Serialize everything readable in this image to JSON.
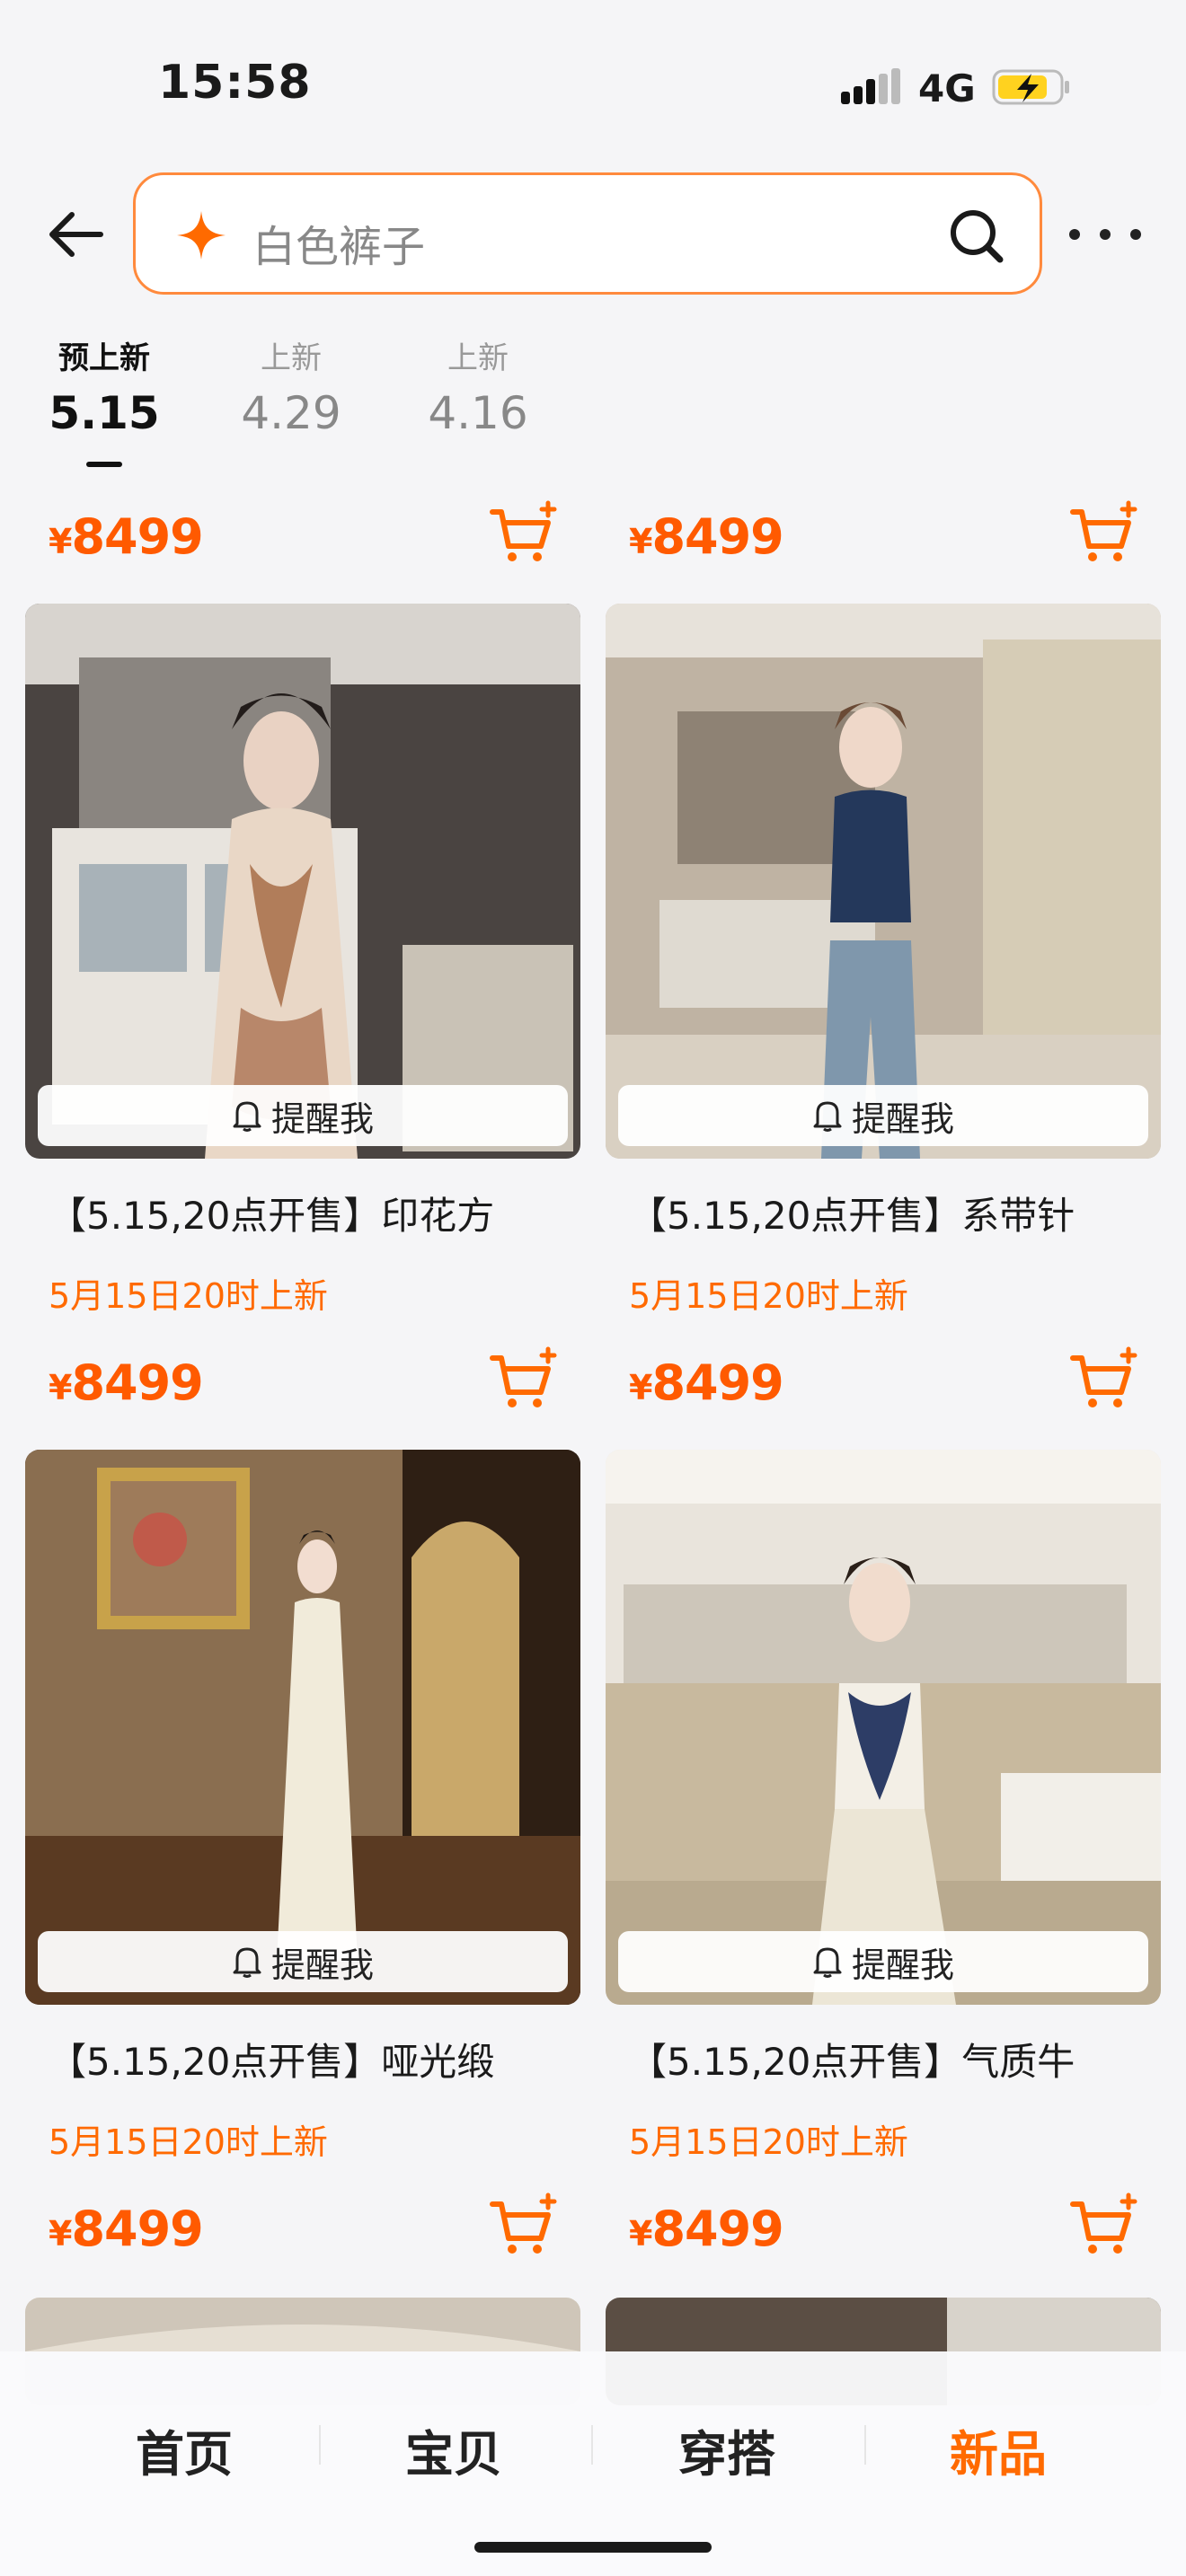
{
  "status_bar": {
    "time": "15:58",
    "network": "4G"
  },
  "search": {
    "query": "白色裤子"
  },
  "date_tabs": [
    {
      "label": "预上新",
      "date": "5.15",
      "active": true
    },
    {
      "label": "上新",
      "date": "4.29",
      "active": false
    },
    {
      "label": "上新",
      "date": "4.16",
      "active": false
    }
  ],
  "top_prices": [
    {
      "currency": "¥",
      "amount": "8499"
    },
    {
      "currency": "¥",
      "amount": "8499"
    }
  ],
  "products": [
    {
      "title": "【5.15,20点开售】印花方",
      "launch": "5月15日20时上新",
      "currency": "¥",
      "price": "8499",
      "remind": "提醒我"
    },
    {
      "title": "【5.15,20点开售】系带针",
      "launch": "5月15日20时上新",
      "currency": "¥",
      "price": "8499",
      "remind": "提醒我"
    },
    {
      "title": "【5.15,20点开售】哑光缎",
      "launch": "5月15日20时上新",
      "currency": "¥",
      "price": "8499",
      "remind": "提醒我"
    },
    {
      "title": "【5.15,20点开售】气质牛",
      "launch": "5月15日20时上新",
      "currency": "¥",
      "price": "8499",
      "remind": "提醒我"
    }
  ],
  "bottom_nav": [
    {
      "label": "首页",
      "active": false
    },
    {
      "label": "宝贝",
      "active": false
    },
    {
      "label": "穿搭",
      "active": false
    },
    {
      "label": "新品",
      "active": true
    }
  ],
  "colors": {
    "accent": "#ff6a00",
    "search_border": "#ff8a3d",
    "background": "#f5f5f7"
  }
}
